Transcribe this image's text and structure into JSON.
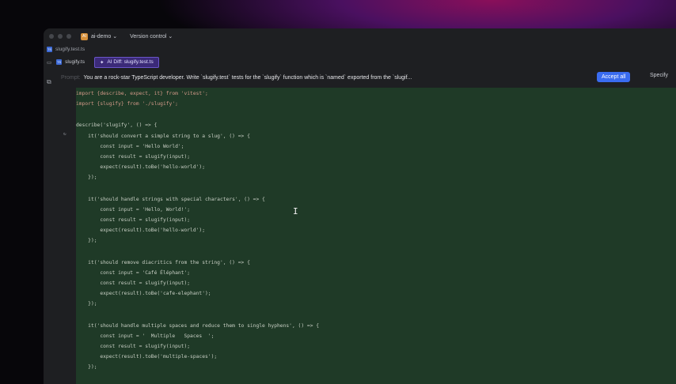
{
  "titlebar": {
    "project_badge": "AI",
    "project": "ai-demo",
    "vcs": "Version control"
  },
  "breadcrumb": {
    "file": "slugify.test.ts"
  },
  "tabs": [
    {
      "label": "slugify.ts"
    },
    {
      "label": "AI Diff: slugify.test.ts"
    }
  ],
  "prompt": {
    "label": "Prompt:",
    "text": "You are a rock-star TypeScript developer. Write `slugify.test` tests for the `slugify` function which is `named` exported from the `slugif...",
    "accept_all": "Accept all",
    "specify": "Specify"
  },
  "code": {
    "lines": [
      "import {describe, expect, it} from 'vitest';",
      "import {slugify} from './slugify';",
      "",
      "describe('slugify', () => {",
      "    it('should convert a simple string to a slug', () => {",
      "        const input = 'Hello World';",
      "        const result = slugify(input);",
      "        expect(result).toBe('hello-world');",
      "    });",
      "",
      "    it('should handle strings with special characters', () => {",
      "        const input = 'Hello, World!';",
      "        const result = slugify(input);",
      "        expect(result).toBe('hello-world');",
      "    });",
      "",
      "    it('should remove diacritics from the string', () => {",
      "        const input = 'Café Éléphant';",
      "        const result = slugify(input);",
      "        expect(result).toBe('cafe-elephant');",
      "    });",
      "",
      "    it('should handle multiple spaces and reduce them to single hyphens', () => {",
      "        const input = '  Multiple   Spaces  ';",
      "        const result = slugify(input);",
      "        expect(result).toBe('multiple-spaces');",
      "    });"
    ]
  }
}
